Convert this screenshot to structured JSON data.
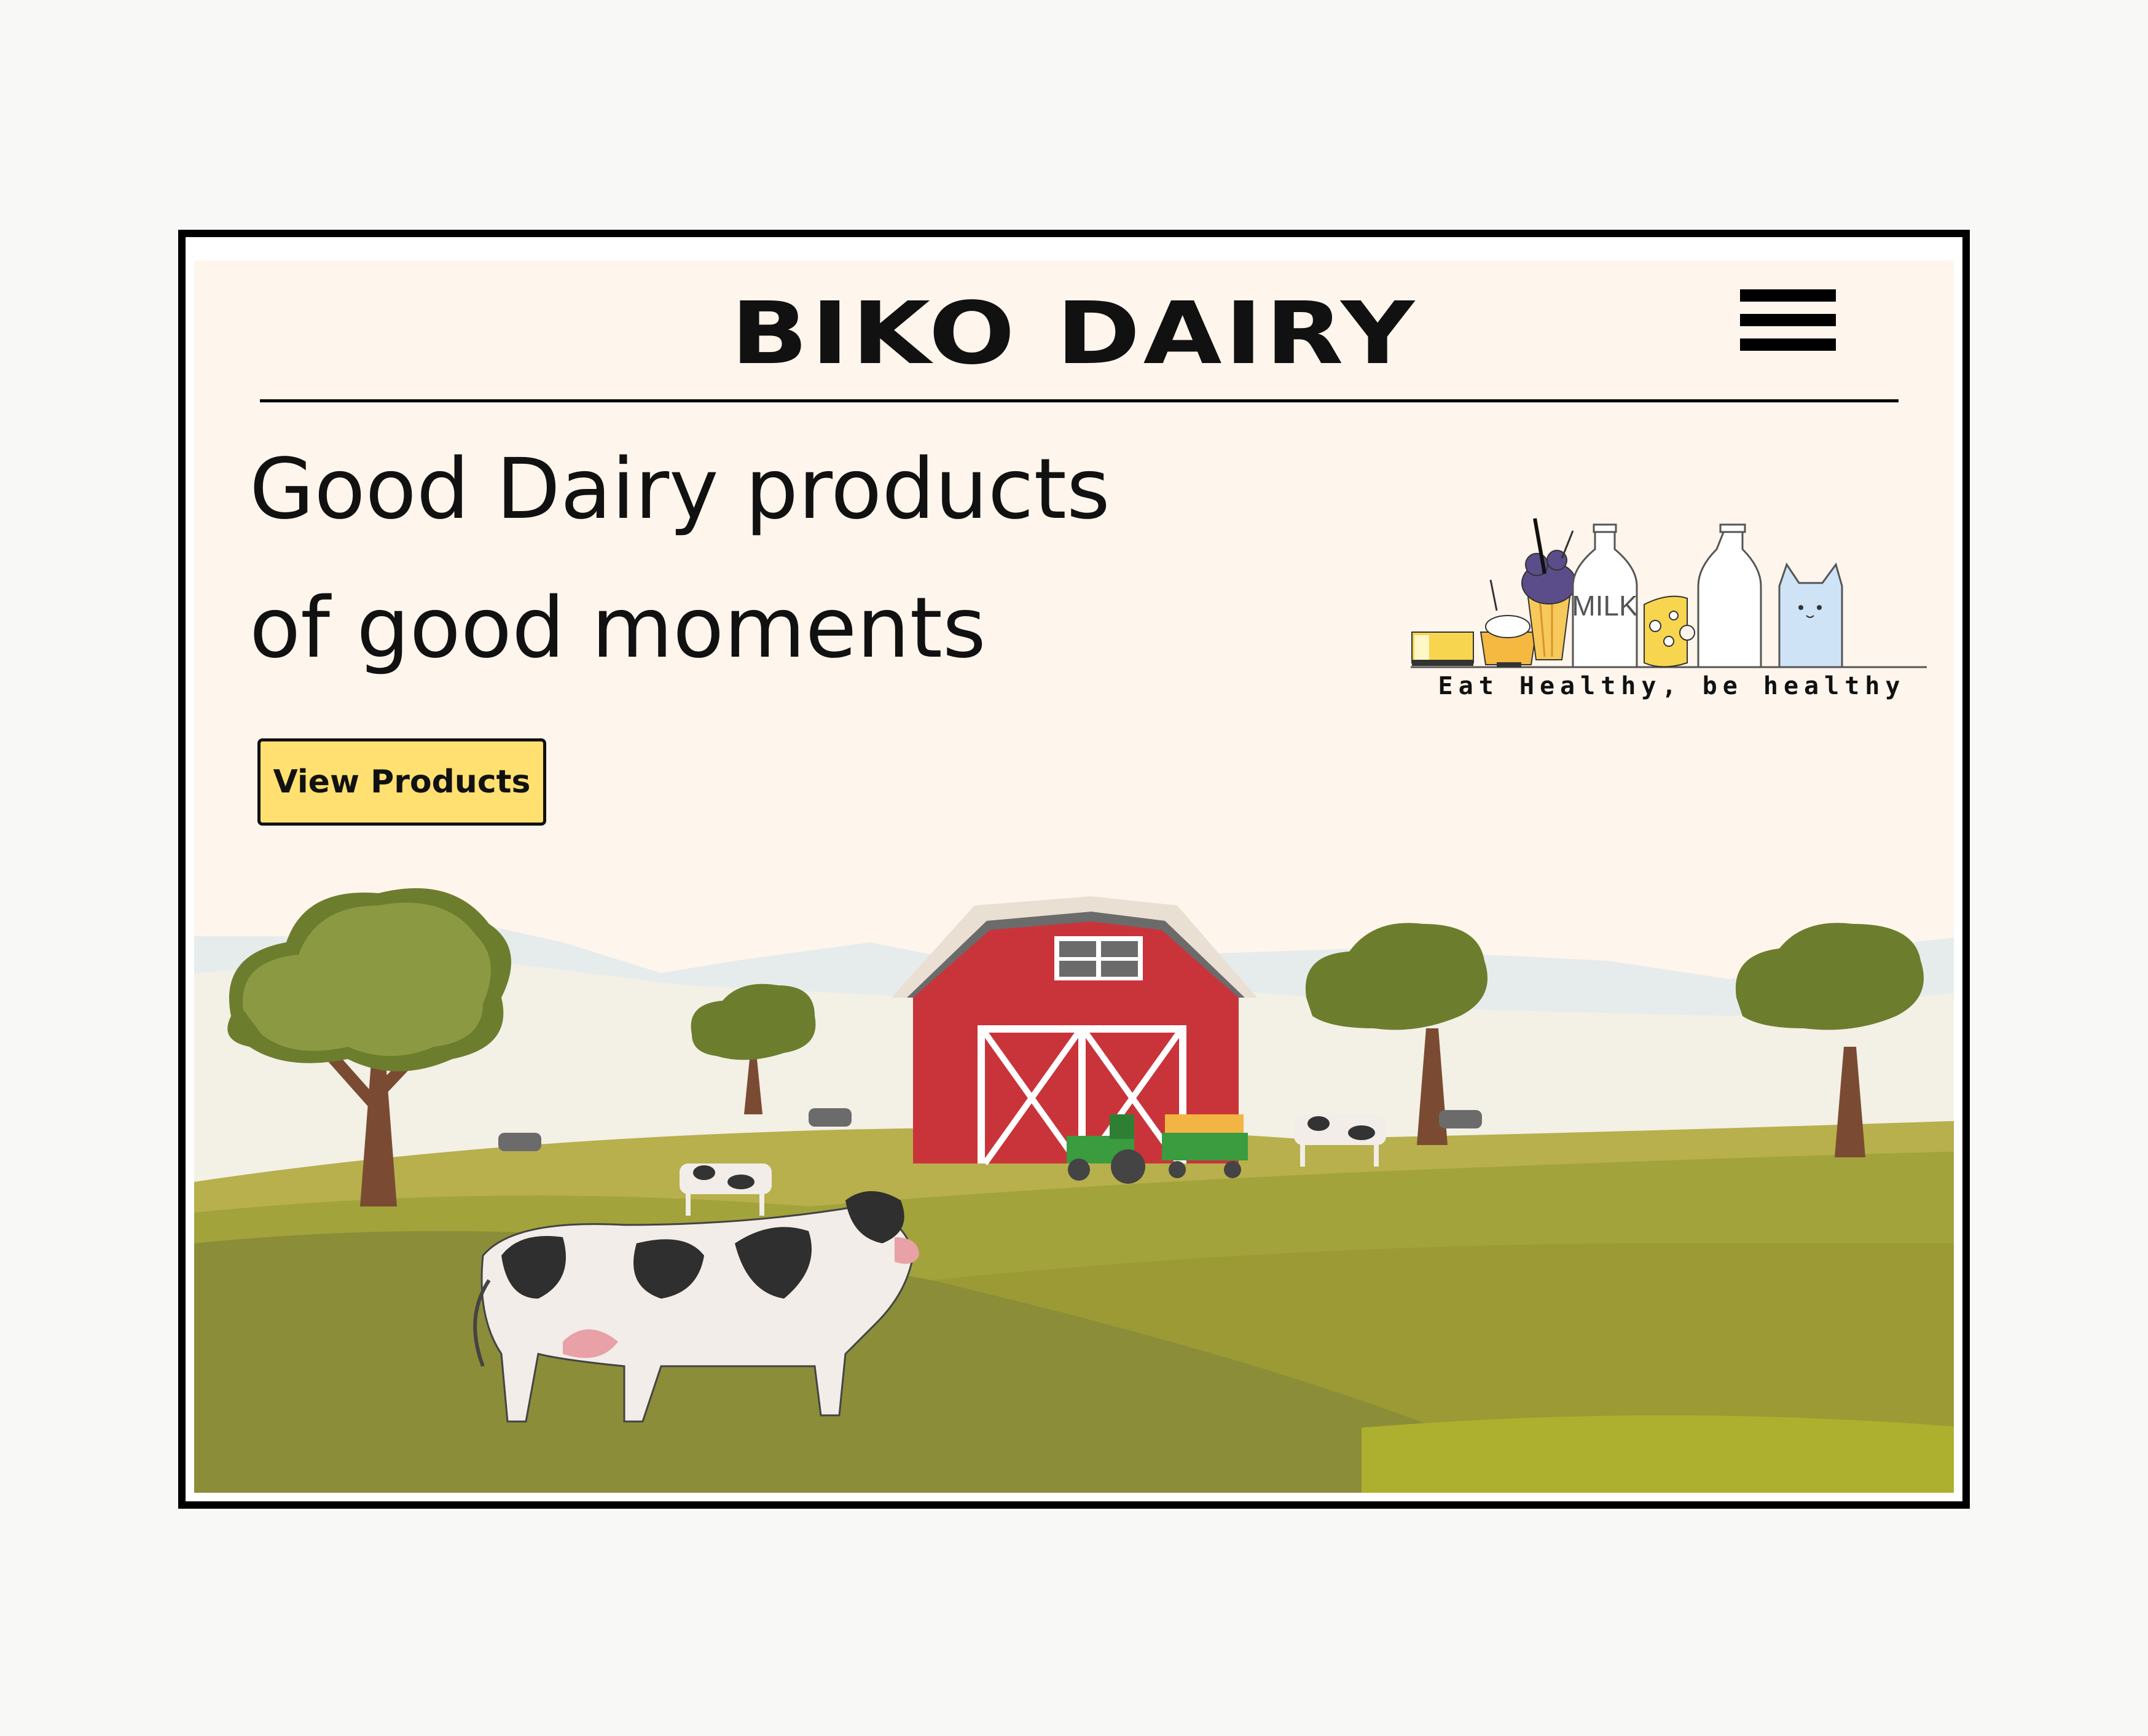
{
  "header": {
    "brand": "BIKO DAIRY",
    "menu_icon": "hamburger-menu-icon"
  },
  "hero": {
    "headline_line1": "Good Dairy products",
    "headline_line2": "of good moments",
    "cta_label": "View Products",
    "product_illustration": {
      "bottle_label": "MILK",
      "tagline": "Eat Healthy, be healthy"
    }
  },
  "colors": {
    "page_background": "#fef5ec",
    "cta_background": "#ffe070",
    "barn_red": "#c9343a",
    "grass": "#9aa03a"
  }
}
